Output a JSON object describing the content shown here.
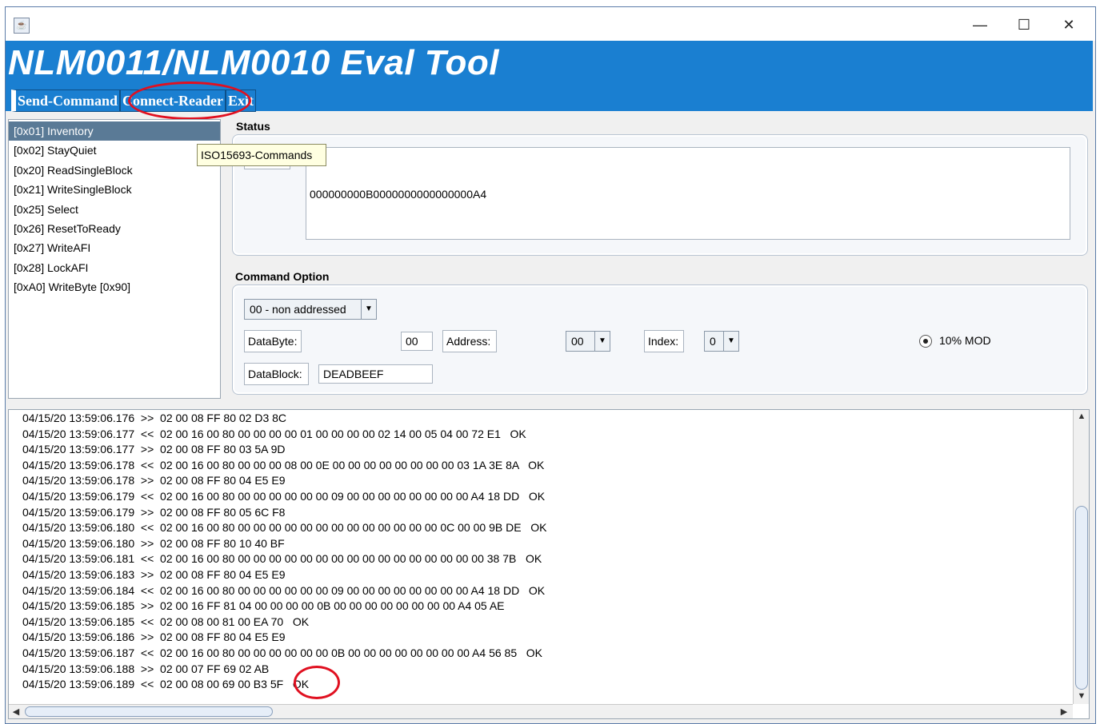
{
  "app": {
    "title": "NLM0011/NLM0010 Eval Tool",
    "window_controls": {
      "minimize": "—",
      "maximize": "☐",
      "close": "✕"
    },
    "accent": "#1a7fd1"
  },
  "menu": [
    {
      "label": "Send-Command"
    },
    {
      "label": "Connect-Reader"
    },
    {
      "label": "Exit"
    }
  ],
  "commands": {
    "selected_index": 0,
    "items": [
      "[0x01] Inventory",
      "[0x02] StayQuiet",
      "[0x20] ReadSingleBlock",
      "[0x21] WriteSingleBlock",
      "[0x25] Select",
      "[0x26] ResetToReady",
      "[0x27] WriteAFI",
      "[0x28] LockAFI",
      "[0xA0] WriteByte [0x90]"
    ],
    "tooltip": "ISO15693-Commands"
  },
  "status": {
    "title": "Status",
    "value": "000000000B0000000000000000A4"
  },
  "command_option": {
    "title": "Command Option",
    "mode": "00 - non addressed",
    "databyte_label": "DataByte:",
    "databyte_value": "00",
    "address_label": "Address:",
    "address_value": "00",
    "index_label": "Index:",
    "index_value": "0",
    "mod_label": "10% MOD",
    "mod_selected": true,
    "datablock_label": "DataBlock:",
    "datablock_value": "DEADBEEF"
  },
  "log": [
    "04/15/20 13:59:06.176  >>  02 00 08 FF 80 02 D3 8C",
    "04/15/20 13:59:06.177  <<  02 00 16 00 80 00 00 00 00 01 00 00 00 00 02 14 00 05 04 00 72 E1   OK",
    "04/15/20 13:59:06.177  >>  02 00 08 FF 80 03 5A 9D",
    "04/15/20 13:59:06.178  <<  02 00 16 00 80 00 00 00 08 00 0E 00 00 00 00 00 00 00 00 03 1A 3E 8A   OK",
    "04/15/20 13:59:06.178  >>  02 00 08 FF 80 04 E5 E9",
    "04/15/20 13:59:06.179  <<  02 00 16 00 80 00 00 00 00 00 00 09 00 00 00 00 00 00 00 00 A4 18 DD   OK",
    "04/15/20 13:59:06.179  >>  02 00 08 FF 80 05 6C F8",
    "04/15/20 13:59:06.180  <<  02 00 16 00 80 00 00 00 00 00 00 00 00 00 00 00 00 00 0C 00 00 9B DE   OK",
    "04/15/20 13:59:06.180  >>  02 00 08 FF 80 10 40 BF",
    "04/15/20 13:59:06.181  <<  02 00 16 00 80 00 00 00 00 00 00 00 00 00 00 00 00 00 00 00 00 38 7B   OK",
    "04/15/20 13:59:06.183  >>  02 00 08 FF 80 04 E5 E9",
    "04/15/20 13:59:06.184  <<  02 00 16 00 80 00 00 00 00 00 00 09 00 00 00 00 00 00 00 00 A4 18 DD   OK",
    "04/15/20 13:59:06.185  >>  02 00 16 FF 81 04 00 00 00 00 0B 00 00 00 00 00 00 00 00 A4 05 AE",
    "04/15/20 13:59:06.185  <<  02 00 08 00 81 00 EA 70   OK",
    "04/15/20 13:59:06.186  >>  02 00 08 FF 80 04 E5 E9",
    "04/15/20 13:59:06.187  <<  02 00 16 00 80 00 00 00 00 00 00 0B 00 00 00 00 00 00 00 00 A4 56 85   OK",
    "04/15/20 13:59:06.188  >>  02 00 07 FF 69 02 AB",
    "04/15/20 13:59:06.189  <<  02 00 08 00 69 00 B3 5F   OK"
  ]
}
